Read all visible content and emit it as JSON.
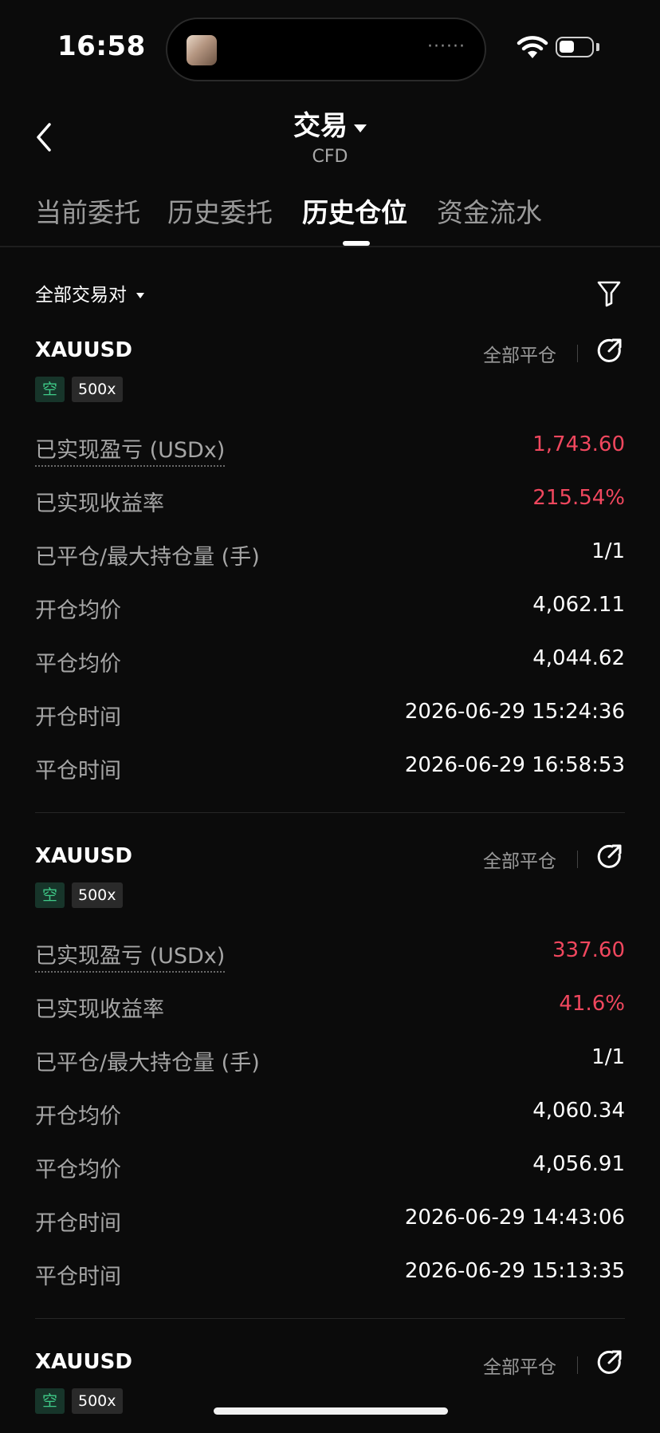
{
  "status": {
    "time": "16:58",
    "island_dots": "······"
  },
  "header": {
    "title": "交易",
    "subtitle": "CFD"
  },
  "tabs": [
    {
      "label": "当前委托",
      "active": false
    },
    {
      "label": "历史委托",
      "active": false
    },
    {
      "label": "历史仓位",
      "active": true
    },
    {
      "label": "资金流水",
      "active": false
    }
  ],
  "filter": {
    "label": "全部交易对"
  },
  "labels": {
    "realized_pnl": "已实现盈亏 (USDx)",
    "realized_roi": "已实现收益率",
    "closed_max": "已平仓/最大持仓量 (手)",
    "open_avg": "开仓均价",
    "close_avg": "平仓均价",
    "open_time": "开仓时间",
    "close_time": "平仓时间"
  },
  "positions": [
    {
      "symbol": "XAUUSD",
      "close_all": "全部平仓",
      "direction": "空",
      "leverage": "500x",
      "realized_pnl": "1,743.60",
      "realized_roi": "215.54%",
      "closed_max": "1/1",
      "open_avg": "4,062.11",
      "close_avg": "4,044.62",
      "open_time": "2026-06-29 15:24:36",
      "close_time": "2026-06-29 16:58:53"
    },
    {
      "symbol": "XAUUSD",
      "close_all": "全部平仓",
      "direction": "空",
      "leverage": "500x",
      "realized_pnl": "337.60",
      "realized_roi": "41.6%",
      "closed_max": "1/1",
      "open_avg": "4,060.34",
      "close_avg": "4,056.91",
      "open_time": "2026-06-29 14:43:06",
      "close_time": "2026-06-29 15:13:35"
    },
    {
      "symbol": "XAUUSD",
      "close_all": "全部平仓",
      "direction": "空",
      "leverage": "500x"
    }
  ],
  "colors": {
    "profit": "#f0475e",
    "short_tag": "#3fca88",
    "background": "#0b0b0b"
  }
}
